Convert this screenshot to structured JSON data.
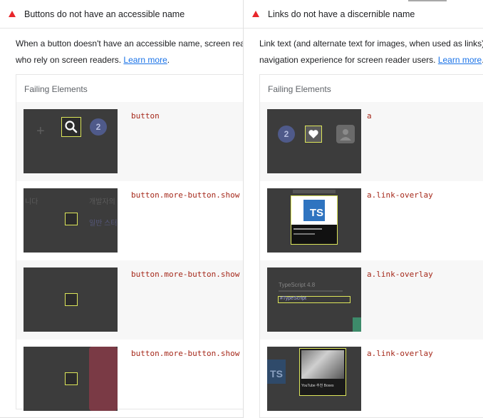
{
  "left": {
    "title": "Buttons do not have an accessible name",
    "desc_line1": "When a button doesn't have an accessible name, screen readers",
    "desc_line2": "who rely on screen readers. ",
    "learn_more": "Learn more",
    "desc_end": ".",
    "failing_label": "Failing Elements",
    "rows": [
      {
        "selector": "button"
      },
      {
        "selector": "button.more-button.show"
      },
      {
        "selector": "button.more-button.show"
      },
      {
        "selector": "button.more-button.show"
      }
    ]
  },
  "right": {
    "title": "Links do not have a discernible name",
    "desc_line1": "Link text (and alternate text for images, when used as links) that",
    "desc_line2": "navigation experience for screen reader users. ",
    "learn_more": "Learn more",
    "desc_end": ".",
    "failing_label": "Failing Elements",
    "rows": [
      {
        "selector": "a"
      },
      {
        "selector": "a.link-overlay"
      },
      {
        "selector": "a.link-overlay"
      },
      {
        "selector": "a.link-overlay"
      }
    ]
  },
  "thumbs": {
    "badge_number": "2",
    "ts_logo": "TS",
    "korean_1": "니다",
    "korean_2": "개발자의",
    "korean_3": "일반 스터",
    "typescript": "TypeScript 4.8",
    "tag_text": "#TypeScript",
    "photo_caption": "YouTube 추천 Boxes"
  },
  "colors": {
    "fail_red": "#e8262b",
    "link_blue": "#1a73e8",
    "selector_red": "#a5281a",
    "highlight": "#dde65a"
  }
}
